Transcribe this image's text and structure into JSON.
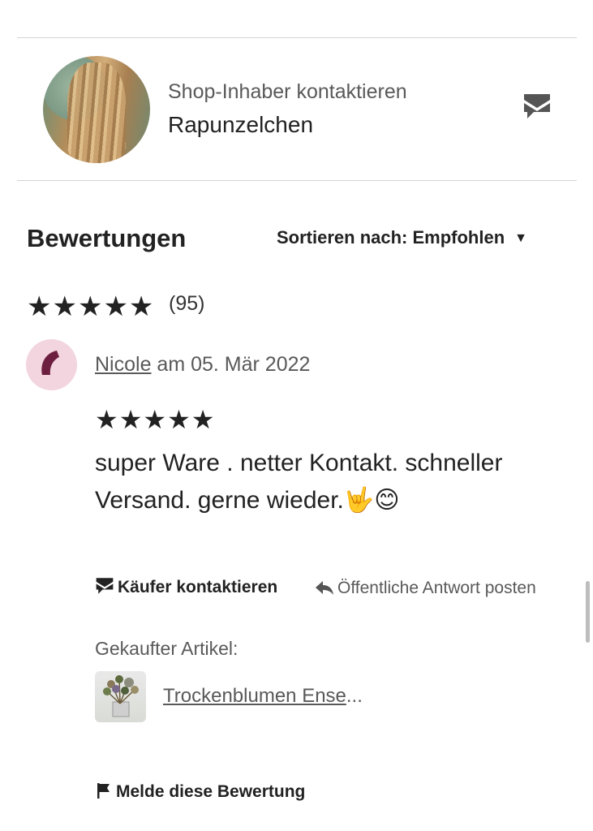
{
  "shop_owner": {
    "contact_label": "Shop-Inhaber kontaktieren",
    "name": "Rapunzelchen",
    "message_icon": "message-icon"
  },
  "reviews": {
    "title": "Bewertungen",
    "sort_label": "Sortieren nach: Empfohlen",
    "sort_caret": "▼",
    "overall_stars": "★★★★★",
    "overall_rating": 5,
    "count": "(95)"
  },
  "review": {
    "reviewer_name": "Nicole",
    "date_text": " am 05. Mär 2022",
    "stars": "★★★★★",
    "rating": 5,
    "text": "super Ware . netter Kontakt. schneller Versand. gerne wieder.🤟😊",
    "contact_buyer_label": "Käufer kontaktieren",
    "public_reply_label": "Öffentliche Antwort posten",
    "purchased_label": "Gekaufter Artikel:",
    "item_name": "Trockenblumen Ense",
    "item_ellipsis": "...",
    "report_label": "Melde diese Bewertung"
  }
}
